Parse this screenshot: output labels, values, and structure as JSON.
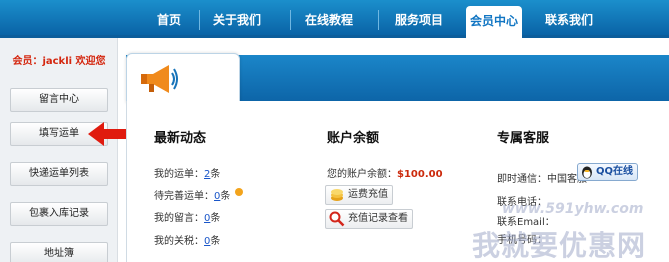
{
  "nav": {
    "items": [
      {
        "label": "首页"
      },
      {
        "label": "关于我们"
      },
      {
        "label": "在线教程"
      },
      {
        "label": "服务项目"
      },
      {
        "label": "会员中心"
      },
      {
        "label": "联系我们"
      }
    ],
    "active": "会员中心"
  },
  "sidebar": {
    "welcome": "会员：jackli 欢迎您",
    "buttons": [
      {
        "label": "留言中心"
      },
      {
        "label": "填写运单"
      },
      {
        "label": "快递运单列表"
      },
      {
        "label": "包裹入库记录"
      },
      {
        "label": "地址簿"
      }
    ]
  },
  "latest": {
    "title": "最新动态",
    "rows": [
      {
        "label": "我的运单：",
        "value": "2",
        "unit": "条"
      },
      {
        "label": "待完善运单：",
        "value": "0",
        "unit": "条"
      },
      {
        "label": "我的留言：",
        "value": "0",
        "unit": "条"
      },
      {
        "label": "我的关税：",
        "value": "0",
        "unit": "条"
      }
    ]
  },
  "balance": {
    "title": "账户余额",
    "label": "您的账户余额：",
    "amount": "$100.00",
    "recharge_btn": "运费充值",
    "records_btn": "充值记录查看"
  },
  "service": {
    "title": "专属客服",
    "im_label": "即时通信：",
    "im_value": "中国客服一",
    "qq_btn": "QQ在线",
    "phone_label": "联系电话：",
    "email_label": "联系Email：",
    "mobile_label": "手机号码："
  },
  "watermark": {
    "url": "www.591yhw.com",
    "text": "我就要优惠网"
  },
  "colors": {
    "nav_bg": "#0a63a6",
    "accent_red": "#d4260e",
    "link_blue": "#1a56c9"
  }
}
